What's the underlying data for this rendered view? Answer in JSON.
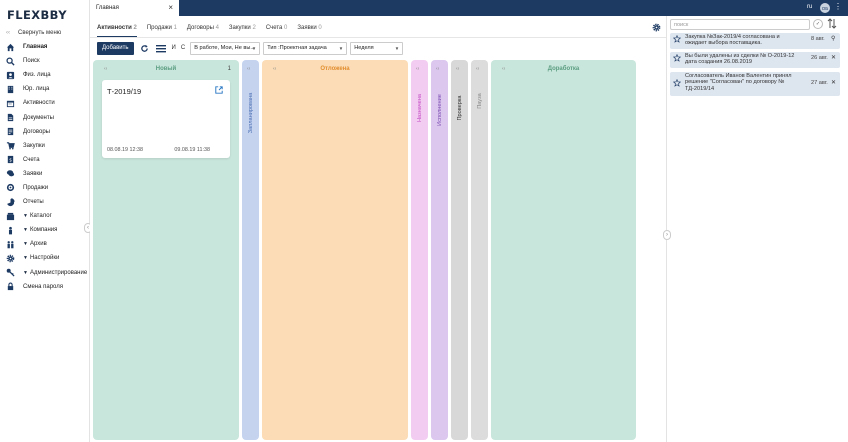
{
  "app": {
    "logo_text": "FLEXBBY",
    "brand_color": "#1d3a63"
  },
  "sidebar": {
    "collapse_label": "Свернуть меню",
    "items": [
      {
        "label": "Главная",
        "icon": "home-icon",
        "active": true
      },
      {
        "label": "Поиск",
        "icon": "search-icon"
      },
      {
        "label": "Физ. лица",
        "icon": "person-icon"
      },
      {
        "label": "Юр. лица",
        "icon": "building-icon"
      },
      {
        "label": "Активности",
        "icon": "calendar-icon"
      },
      {
        "label": "Документы",
        "icon": "document-icon"
      },
      {
        "label": "Договоры",
        "icon": "contract-icon"
      },
      {
        "label": "Закупки",
        "icon": "cart-icon"
      },
      {
        "label": "Счета",
        "icon": "invoice-icon"
      },
      {
        "label": "Заявки",
        "icon": "chat-icon"
      },
      {
        "label": "Продажи",
        "icon": "target-icon"
      },
      {
        "label": "Отчеты",
        "icon": "chart-icon"
      },
      {
        "label": "Каталог",
        "icon": "box-icon",
        "expandable": true
      },
      {
        "label": "Компания",
        "icon": "users-icon",
        "expandable": true
      },
      {
        "label": "Архив",
        "icon": "archive-icon",
        "expandable": true
      },
      {
        "label": "Настройки",
        "icon": "gear-icon",
        "expandable": true
      },
      {
        "label": "Администрирование",
        "icon": "key-icon",
        "expandable": true
      },
      {
        "label": "Смена пароля",
        "icon": "lock-icon"
      }
    ]
  },
  "topbar": {
    "main_tab": "Главная",
    "lang": "ru",
    "avatar": "ОБ"
  },
  "subtabs": [
    {
      "label": "Активности",
      "count": "2",
      "active": true
    },
    {
      "label": "Продажи",
      "count": "1"
    },
    {
      "label": "Договоры",
      "count": "4"
    },
    {
      "label": "Закупки",
      "count": "2"
    },
    {
      "label": "Счета",
      "count": "0"
    },
    {
      "label": "Заявки",
      "count": "0"
    }
  ],
  "toolbar": {
    "add_label": "Добавить",
    "and_label": "И",
    "from_label": "С",
    "status_filter": "В работе, Мои, Не вы...",
    "type_filter": "Тип :Проектная задача",
    "period_filter": "Неделя"
  },
  "kanban": {
    "columns": [
      {
        "title": "Новый",
        "count": "1",
        "color": "#c9e6dc",
        "text_color": "#5b9e82"
      },
      {
        "title": "Запланирована",
        "color": "#c5d3ef",
        "text_color": "#4a6eb3",
        "vertical": true
      },
      {
        "title": "Отложена",
        "color": "#fbdcb6",
        "text_color": "#e38e2f"
      },
      {
        "title": "Назначена",
        "color": "#f3cdf1",
        "text_color": "#c34ac3",
        "vertical": true
      },
      {
        "title": "Исполнение",
        "color": "#dcc8ef",
        "text_color": "#7a49b0",
        "vertical": true
      },
      {
        "title": "Проверка",
        "color": "#d8d8d8",
        "text_color": "#333",
        "vertical": true
      },
      {
        "title": "Пауза",
        "color": "#dcdcdc",
        "text_color": "#888",
        "vertical": true
      },
      {
        "title": "Доработка",
        "color": "#c9e6dc",
        "text_color": "#5b9e82"
      }
    ],
    "card": {
      "title": "Т-2019/19",
      "date_start": "08.08.19 12:38",
      "date_end": "09.08.19 11:38"
    }
  },
  "notifications": {
    "search_placeholder": "поиск",
    "items": [
      {
        "text": "Закупка №Зак-2019/4 согласована и ожидает выбора поставщика.",
        "date": "8 авг.",
        "pinned": true
      },
      {
        "text": "Вы были удалены из сделки № О-2019-12 дата создания 26.08.2019",
        "date": "26 авг."
      },
      {
        "text": "Согласователь Иванов Валентин принял решение \"Согласован\" по договору № ТД-2019/14",
        "date": "27 авг."
      }
    ]
  }
}
